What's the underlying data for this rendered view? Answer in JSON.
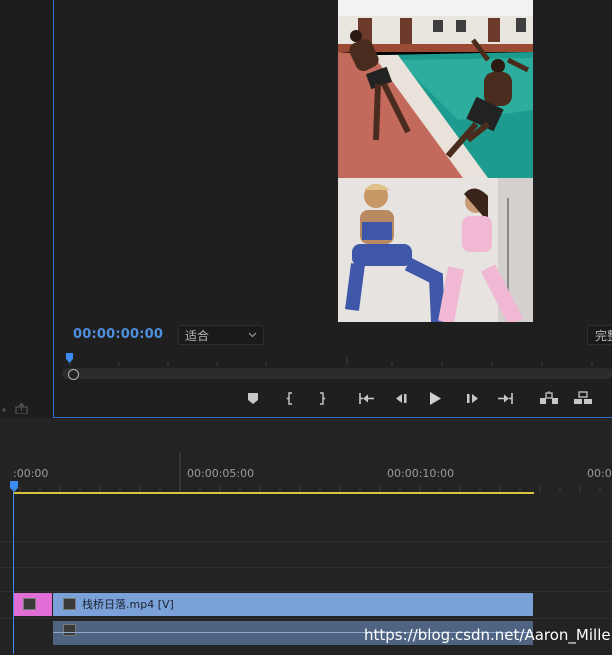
{
  "program_monitor": {
    "timecode": "00:00:00:00",
    "fit_label": "适合",
    "quality_label": "完整",
    "accent_color": "#4f8fe0"
  },
  "transport_controls": [
    {
      "name": "add-marker-button",
      "icon": "marker-icon"
    },
    {
      "name": "mark-in-button",
      "icon": "mark-in-icon"
    },
    {
      "name": "mark-out-button",
      "icon": "mark-out-icon"
    },
    {
      "name": "go-to-in-button",
      "icon": "go-to-in-icon"
    },
    {
      "name": "step-back-button",
      "icon": "step-back-icon"
    },
    {
      "name": "play-button",
      "icon": "play-icon"
    },
    {
      "name": "step-forward-button",
      "icon": "step-forward-icon"
    },
    {
      "name": "go-to-out-button",
      "icon": "go-to-out-icon"
    },
    {
      "name": "lift-button",
      "icon": "lift-icon"
    },
    {
      "name": "extract-button",
      "icon": "extract-icon"
    }
  ],
  "timeline": {
    "ruler_labels": [
      ":00:00",
      "00:00:05:00",
      "00:00:10:00",
      "00:0"
    ],
    "clips": {
      "video_main_title": "栈桥日落.mp4 [V]"
    },
    "work_area_color": "#d9c53a",
    "video_clip_color": "#7ba2d8",
    "adjustment_clip_color": "#e06ed6",
    "audio_clip_color": "#4f6382"
  },
  "watermark": "https://blog.csdn.net/Aaron_Miller"
}
